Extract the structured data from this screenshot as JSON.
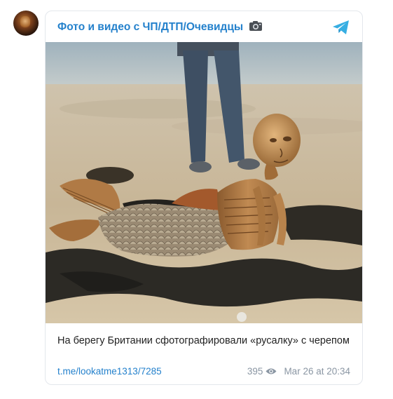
{
  "channel": {
    "title": "Фото и видео с ЧП/ДТП/Очевидцы",
    "title_icon": "camera-icon",
    "avatar_icon": "channel-avatar",
    "platform_icon": "telegram-icon"
  },
  "post": {
    "caption": "На берегу Британии сфотографировали «русалку» с черепом",
    "link": "t.me/lookatme1313/7285",
    "views": "395",
    "views_icon": "eye-icon",
    "date": "Mar 26 at 20:34"
  },
  "colors": {
    "accent": "#2481cc",
    "meta": "#8a96a3",
    "text": "#222222",
    "border": "#e3e7ec"
  }
}
